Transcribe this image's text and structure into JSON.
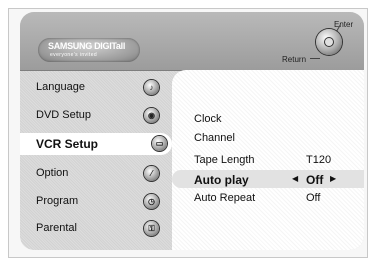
{
  "header": {
    "logo": {
      "brand": "SAMSUNG DIGITall",
      "tagline": "everyone's invited"
    },
    "enter_label": "Enter",
    "return_label": "Return"
  },
  "sidebar": {
    "items": [
      {
        "label": "Language",
        "icon": "language-icon",
        "active": false
      },
      {
        "label": "DVD Setup",
        "icon": "disc-icon",
        "active": false
      },
      {
        "label": "VCR Setup",
        "icon": "vcr-icon",
        "active": true
      },
      {
        "label": "Option",
        "icon": "option-icon",
        "active": false
      },
      {
        "label": "Program",
        "icon": "program-icon",
        "active": false
      },
      {
        "label": "Parental",
        "icon": "lock-icon",
        "active": false
      }
    ]
  },
  "settings": {
    "rows": [
      {
        "name": "Clock",
        "value": ""
      },
      {
        "name": "Channel",
        "value": ""
      },
      {
        "name": "Tape Length",
        "value": "T120"
      },
      {
        "name": "Auto play",
        "value": "Off",
        "selected": true
      },
      {
        "name": "Auto Repeat",
        "value": "Off"
      }
    ]
  },
  "colors": {
    "header_bg": "#a8a8a8",
    "content_bg": "#ffffff",
    "selected_row_bg": "#e2e2e2"
  }
}
